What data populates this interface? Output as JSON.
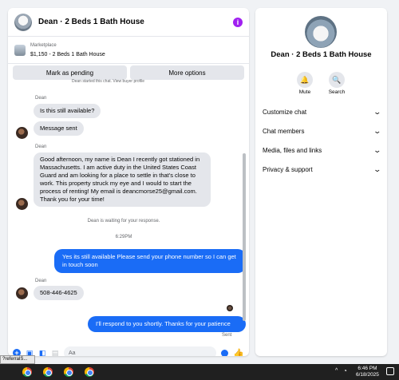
{
  "header": {
    "title": "Dean · 2 Beds 1 Bath House"
  },
  "marketplace": {
    "label": "Marketplace",
    "item": "$1,150 - 2 Beds 1 Bath House"
  },
  "actions": {
    "mark_pending": "Mark as pending",
    "more_options": "More options"
  },
  "messages": {
    "clipped_top": "Dean started this chat. View buyer profile",
    "sender1": "Dean",
    "m1": "Is this still available?",
    "m2": "Message sent",
    "sender2": "Dean",
    "m3": "Good afternoon, my name is Dean I recently got stationed in Massachusetts. I am active duty in the United States Coast Guard and am looking for a place to settle in that's close to work. This property struck my eye and I would to start the process of renting! My email is deancmorse25@gmail.com. Thank you for your time!",
    "waiting": "Dean is waiting for your response.",
    "time": "6:29PM",
    "reply1": "Yes its still available Please send your phone number so I can get in touch soon",
    "sender3": "Dean",
    "m4": "508-446-4625",
    "reply2": "I'll respond to you shortly. Thanks for your patience",
    "sent": "Sent"
  },
  "composer": {
    "placeholder": "Aa"
  },
  "info_panel": {
    "title": "Dean · 2 Beds 1 Bath House",
    "mute_label": "Mute",
    "search_label": "Search",
    "sections": [
      "Customize chat",
      "Chat members",
      "Media, files and links",
      "Privacy & support"
    ]
  },
  "taskbar": {
    "tooltip": "?referralS...",
    "time": "6:46 PM",
    "date": "6/18/2025"
  },
  "colors": {
    "accent": "#1a6cf6",
    "info_icon": "#a020f0"
  },
  "icons": [
    "info-icon",
    "bell-icon",
    "search-icon",
    "chevron-down-icon",
    "plus-icon",
    "image-icon",
    "sticker-icon",
    "gif-icon",
    "emoji-icon",
    "thumbs-up-icon",
    "chrome-icon",
    "wifi-icon"
  ]
}
